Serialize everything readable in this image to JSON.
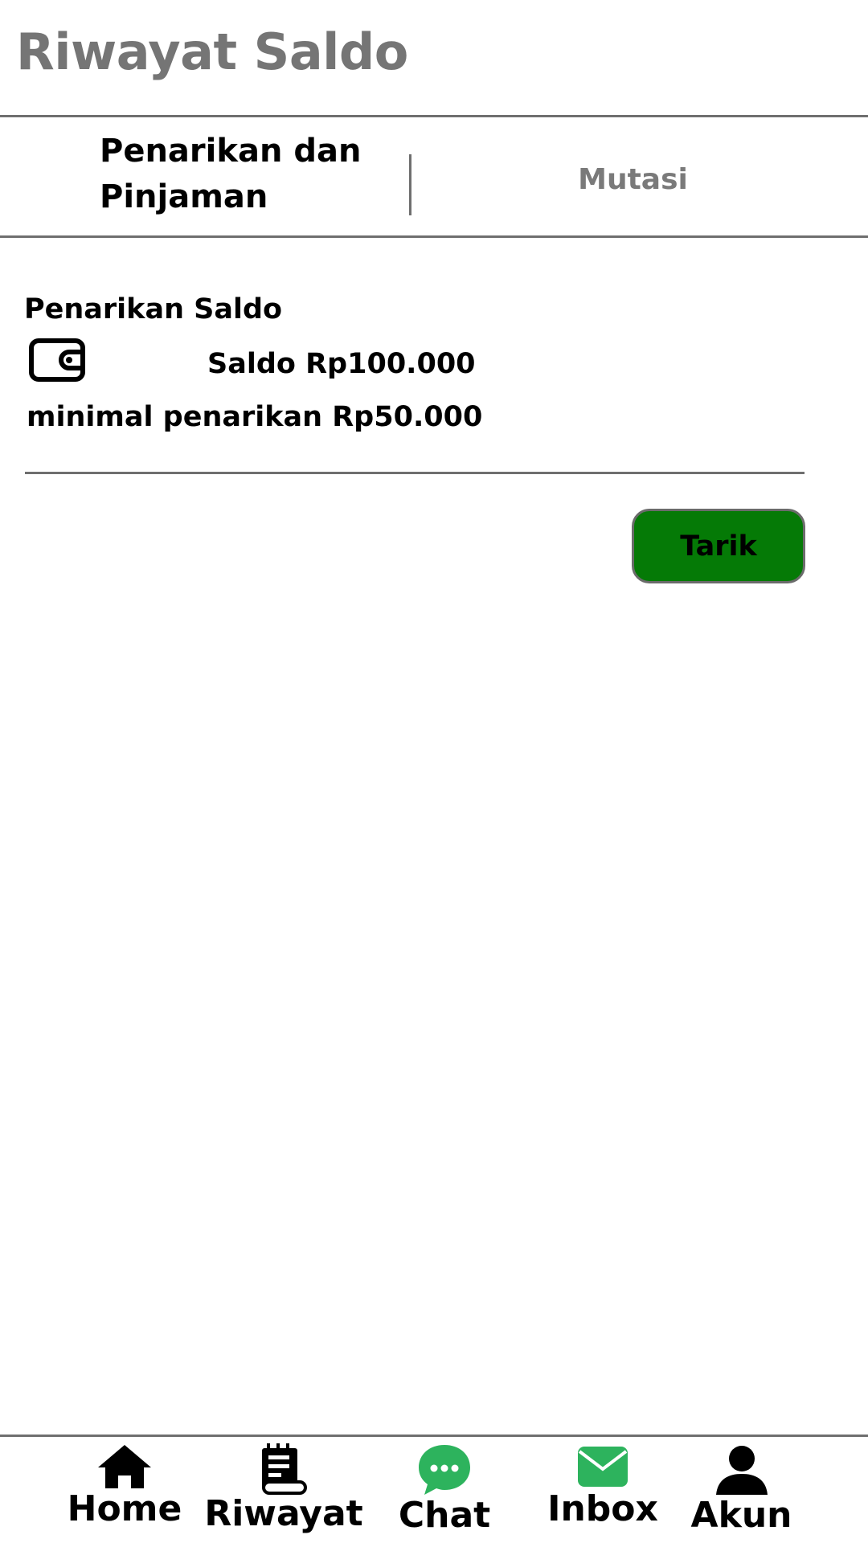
{
  "header": {
    "title": "Riwayat Saldo"
  },
  "tabs": [
    {
      "label": "Penarikan dan Pinjaman",
      "active": true
    },
    {
      "label": "Mutasi",
      "active": false
    }
  ],
  "withdrawal": {
    "section_title": "Penarikan Saldo",
    "icon": "wallet-icon",
    "balance_text": "Saldo Rp100.000",
    "minimum_text": "minimal penarikan Rp50.000",
    "button_label": "Tarik",
    "button_color": "#057a06"
  },
  "bottom_nav": [
    {
      "label": "Home",
      "icon": "home-icon"
    },
    {
      "label": "Riwayat",
      "icon": "history-icon"
    },
    {
      "label": "Chat",
      "icon": "chat-icon",
      "color": "#2db35d"
    },
    {
      "label": "Inbox",
      "icon": "mail-icon",
      "color": "#2db35d"
    },
    {
      "label": "Akun",
      "icon": "user-icon"
    }
  ],
  "colors": {
    "title_gray": "#757575",
    "inactive_tab_gray": "#7a7a7a",
    "divider_gray": "#6f6f6f",
    "accent_green": "#2db35d"
  }
}
